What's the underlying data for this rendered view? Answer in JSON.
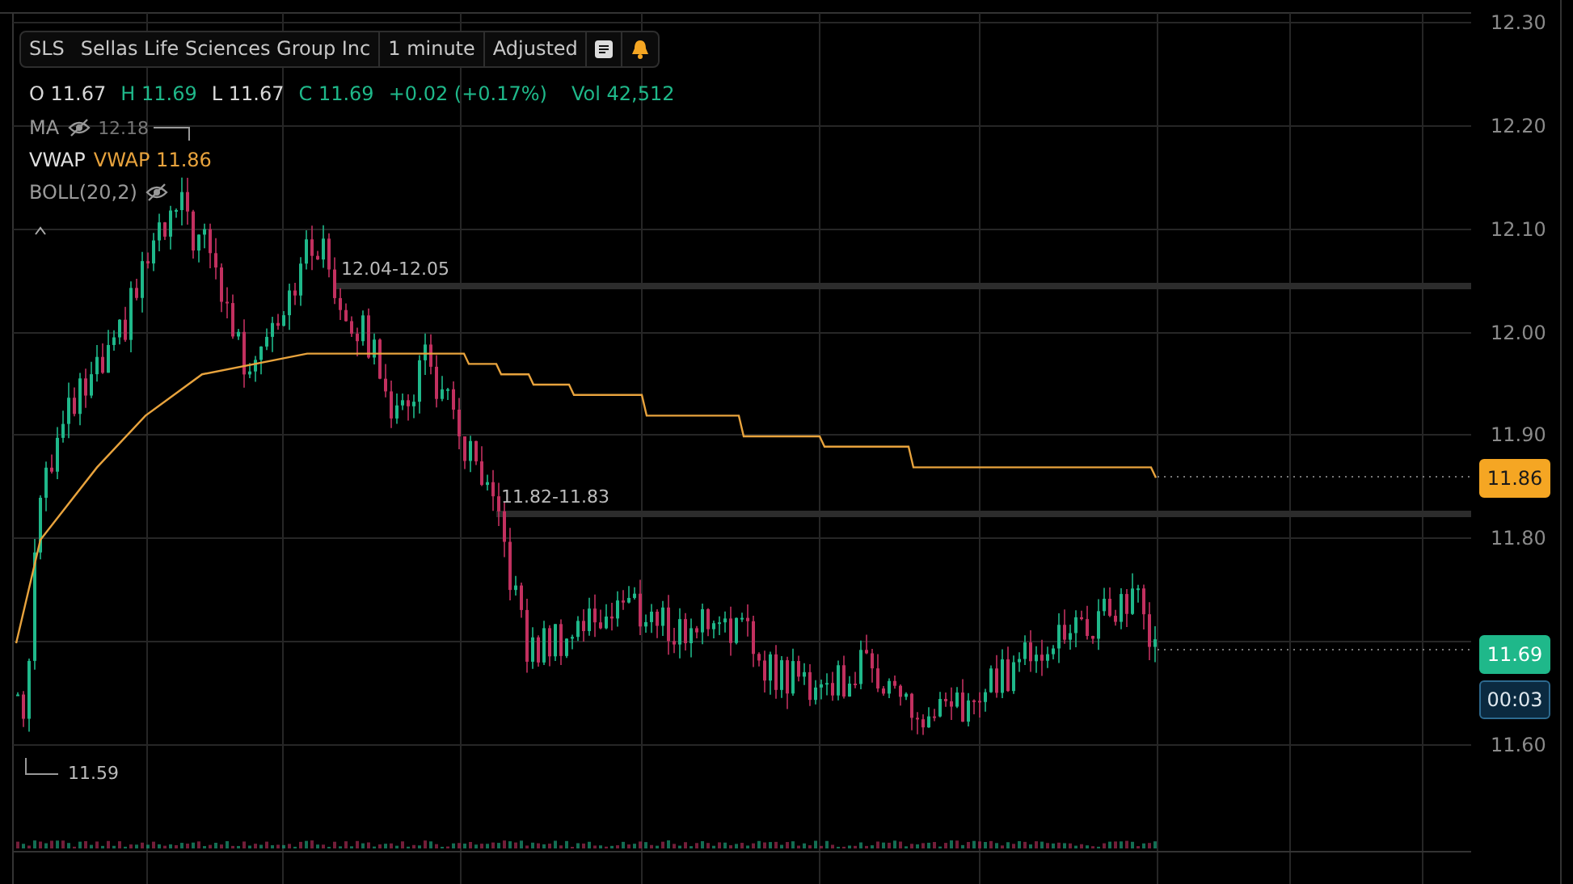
{
  "header": {
    "symbol": "SLS",
    "name": "Sellas Life Sciences Group Inc",
    "interval": "1 minute",
    "adjustment": "Adjusted"
  },
  "quote": [
    {
      "label": "O",
      "value": "11.67",
      "kind": "plain"
    },
    {
      "label": "H",
      "value": "11.69",
      "kind": "up"
    },
    {
      "label": "L",
      "value": "11.67",
      "kind": "plain"
    },
    {
      "label": "C",
      "value": "11.69",
      "kind": "up"
    }
  ],
  "change": "+0.02 (+0.17%)",
  "volume": {
    "label": "Vol",
    "value": "42,512"
  },
  "indicators": [
    {
      "name": "MA",
      "hidden": true,
      "value": "12.18"
    },
    {
      "name": "VWAP",
      "hidden": false,
      "value": "VWAP 11.86"
    },
    {
      "name": "BOLL(20,2)",
      "hidden": true
    }
  ],
  "zones": [
    "12.04-12.05",
    "11.82-11.83"
  ],
  "low_marker": "11.59",
  "axis_ticks": [
    "12.30",
    "12.20",
    "12.10",
    "12.00",
    "11.90",
    "11.80",
    "11.60"
  ],
  "price_tags": [
    {
      "value": "11.86",
      "kind": "vwap"
    },
    {
      "value": "11.69",
      "kind": "last"
    },
    {
      "value": "00:03",
      "kind": "countdown"
    }
  ]
}
